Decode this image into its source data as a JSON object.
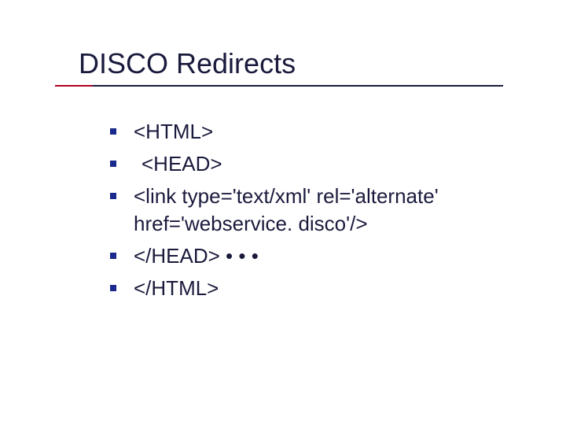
{
  "slide": {
    "title": "DISCO Redirects",
    "items": [
      {
        "text": "<HTML>",
        "indent": false
      },
      {
        "text": "<HEAD>",
        "indent": true
      },
      {
        "text": "<link type='text/xml' rel='alternate' href='webservice. disco'/>",
        "indent": false
      },
      {
        "text": "</HEAD> • • •",
        "indent": false
      },
      {
        "text": "</HTML>",
        "indent": false
      }
    ]
  }
}
